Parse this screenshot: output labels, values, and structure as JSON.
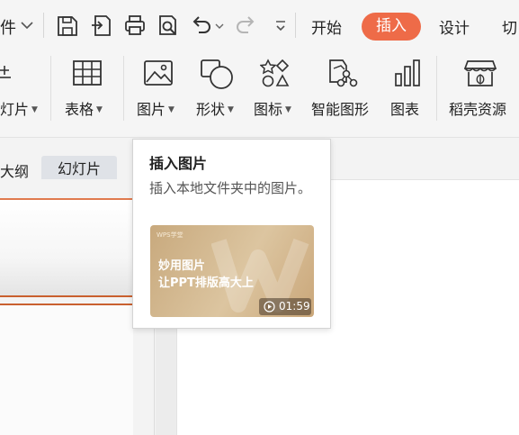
{
  "quick_access": {
    "file_label": "件"
  },
  "tabs": [
    {
      "label": "开始"
    },
    {
      "label": "插入"
    },
    {
      "label": "设计"
    },
    {
      "label": "切"
    }
  ],
  "ribbon": {
    "items": [
      {
        "label": "灯片"
      },
      {
        "label": "表格"
      },
      {
        "label": "图片"
      },
      {
        "label": "形状"
      },
      {
        "label": "图标"
      },
      {
        "label": "智能图形"
      },
      {
        "label": "图表"
      },
      {
        "label": "稻壳资源"
      }
    ]
  },
  "panel_tabs": {
    "outline": "大纲",
    "slides": "幻灯片"
  },
  "tooltip": {
    "title": "插入图片",
    "description": "插入本地文件夹中的图片。",
    "video": {
      "brand": "WPS学堂",
      "line1": "妙用图片",
      "line2": "让PPT排版高大上",
      "duration": "01:59"
    }
  },
  "colors": {
    "accent": "#ee6b48",
    "slide_border": "#c9602f"
  }
}
